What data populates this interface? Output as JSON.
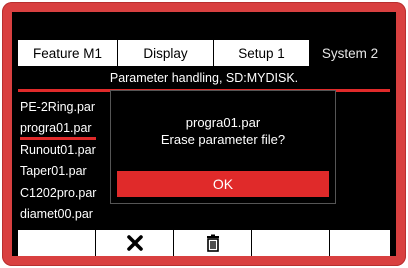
{
  "tabs": [
    {
      "label": "Feature  M1",
      "active": true
    },
    {
      "label": "Display",
      "active": true
    },
    {
      "label": "Setup 1",
      "active": true
    },
    {
      "label": "System 2",
      "active": false
    }
  ],
  "subtitle": "Parameter handling, SD:MYDISK.",
  "files": [
    {
      "name": "PE-2Ring.par",
      "selected": false
    },
    {
      "name": "progra01.par",
      "selected": true
    },
    {
      "name": "Runout01.par",
      "selected": false
    },
    {
      "name": "Taper01.par",
      "selected": false
    },
    {
      "name": "C1202pro.par",
      "selected": false
    },
    {
      "name": "diamet00.par",
      "selected": false
    }
  ],
  "dialog": {
    "filename": "progra01.par",
    "question": "Erase parameter file?",
    "ok_label": "OK"
  },
  "softkeys": [
    {
      "icon": "",
      "name": "softkey-1"
    },
    {
      "icon": "close-icon",
      "name": "cancel-softkey"
    },
    {
      "icon": "trash-icon",
      "name": "delete-softkey"
    },
    {
      "icon": "",
      "name": "softkey-4"
    },
    {
      "icon": "",
      "name": "softkey-5"
    }
  ],
  "colors": {
    "frame": "#d94040",
    "accent": "#e02a2a",
    "screen": "#000000"
  }
}
